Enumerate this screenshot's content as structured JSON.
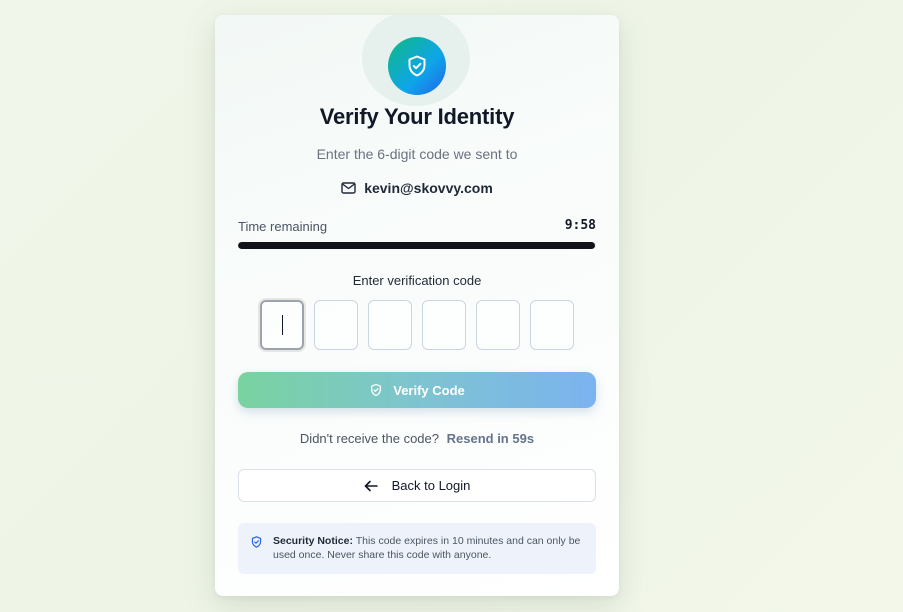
{
  "header": {
    "title": "Verify Your Identity",
    "subtitle": "Enter the 6-digit code we sent to",
    "email": "kevin@skovvy.com"
  },
  "timer": {
    "label": "Time remaining",
    "value": "9:58",
    "progress_percent": 99.7
  },
  "code": {
    "label": "Enter verification code",
    "digits": [
      "",
      "",
      "",
      "",
      "",
      ""
    ],
    "active_index": 0
  },
  "verify_button": {
    "label": "Verify Code"
  },
  "resend": {
    "prompt": "Didn't receive the code?",
    "link": "Resend in 59s"
  },
  "back_button": {
    "label": "Back to Login"
  },
  "notice": {
    "title": "Security Notice:",
    "text": "This code expires in 10 minutes and can only be used once. Never share this code with anyone."
  },
  "colors": {
    "accent_start": "#10b981",
    "accent_end": "#2563eb",
    "progress": "#111318"
  }
}
